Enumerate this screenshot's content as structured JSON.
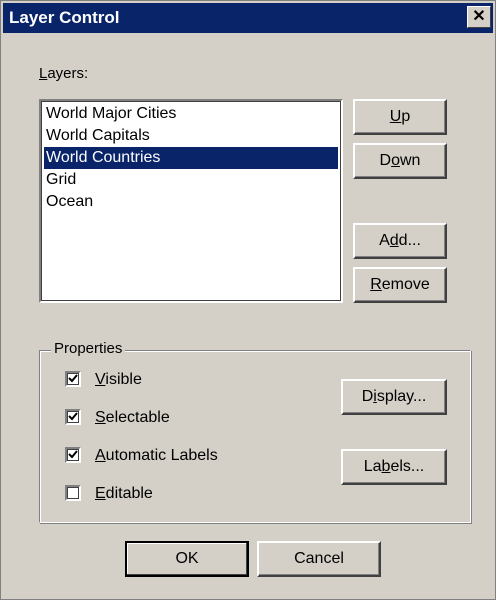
{
  "window": {
    "title": "Layer Control",
    "close_glyph": "✕"
  },
  "layers": {
    "label_accel": "L",
    "label_rest": "ayers:",
    "items": [
      {
        "label": "World Major Cities",
        "selected": false
      },
      {
        "label": "World Capitals",
        "selected": false
      },
      {
        "label": "World Countries",
        "selected": true
      },
      {
        "label": "Grid",
        "selected": false
      },
      {
        "label": "Ocean",
        "selected": false
      }
    ]
  },
  "buttons": {
    "up": {
      "accel": "U",
      "rest": "p"
    },
    "down": {
      "pre": "D",
      "accel": "o",
      "rest": "wn"
    },
    "add": {
      "pre": "A",
      "accel": "d",
      "rest": "d..."
    },
    "remove": {
      "accel": "R",
      "rest": "emove"
    },
    "display": {
      "pre": "D",
      "accel": "i",
      "rest": "splay..."
    },
    "labels": {
      "pre": "La",
      "accel": "b",
      "rest": "els..."
    },
    "ok": "OK",
    "cancel": "Cancel"
  },
  "properties": {
    "title": "Properties",
    "visible": {
      "accel": "V",
      "rest": "isible",
      "checked": true
    },
    "selectable": {
      "accel": "S",
      "rest": "electable",
      "checked": true
    },
    "automatic_labels": {
      "accel": "A",
      "rest": "utomatic Labels",
      "checked": true
    },
    "editable": {
      "accel": "E",
      "rest": "ditable",
      "checked": false
    }
  },
  "colors": {
    "dialog_bg": "#d4d0c8",
    "title_bg": "#0a246a",
    "selection_bg": "#0a246a"
  },
  "icons": {
    "close": "close-icon",
    "check": "check-icon"
  }
}
